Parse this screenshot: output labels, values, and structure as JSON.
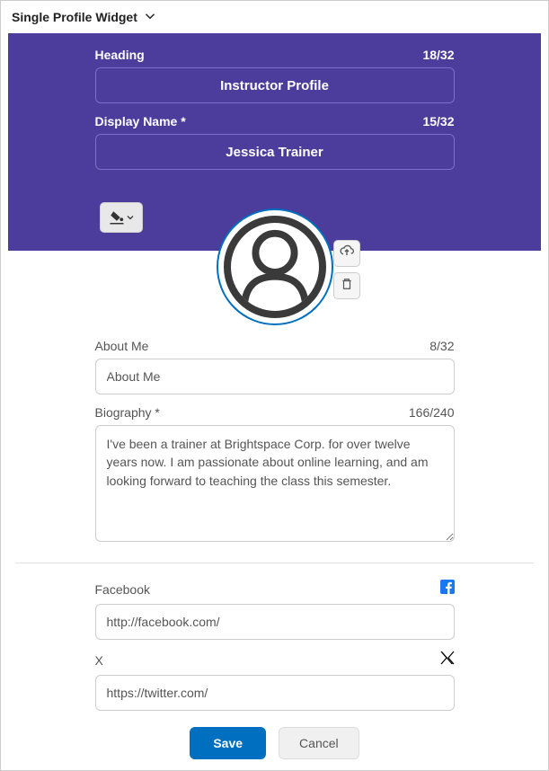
{
  "header": {
    "title": "Single Profile Widget"
  },
  "fields": {
    "heading": {
      "label": "Heading",
      "counter": "18/32",
      "value": "Instructor Profile"
    },
    "display_name": {
      "label": "Display Name *",
      "counter": "15/32",
      "value": "Jessica Trainer"
    },
    "about_me": {
      "label": "About Me",
      "counter": "8/32",
      "value": "About Me"
    },
    "biography": {
      "label": "Biography *",
      "counter": "166/240",
      "value": "I've been a trainer at Brightspace Corp. for over twelve years now. I am passionate about online learning, and am looking forward to teaching the class this semester."
    },
    "facebook": {
      "label": "Facebook",
      "value": "http://facebook.com/"
    },
    "x": {
      "label": "X",
      "value": "https://twitter.com/"
    }
  },
  "buttons": {
    "save": "Save",
    "cancel": "Cancel"
  }
}
